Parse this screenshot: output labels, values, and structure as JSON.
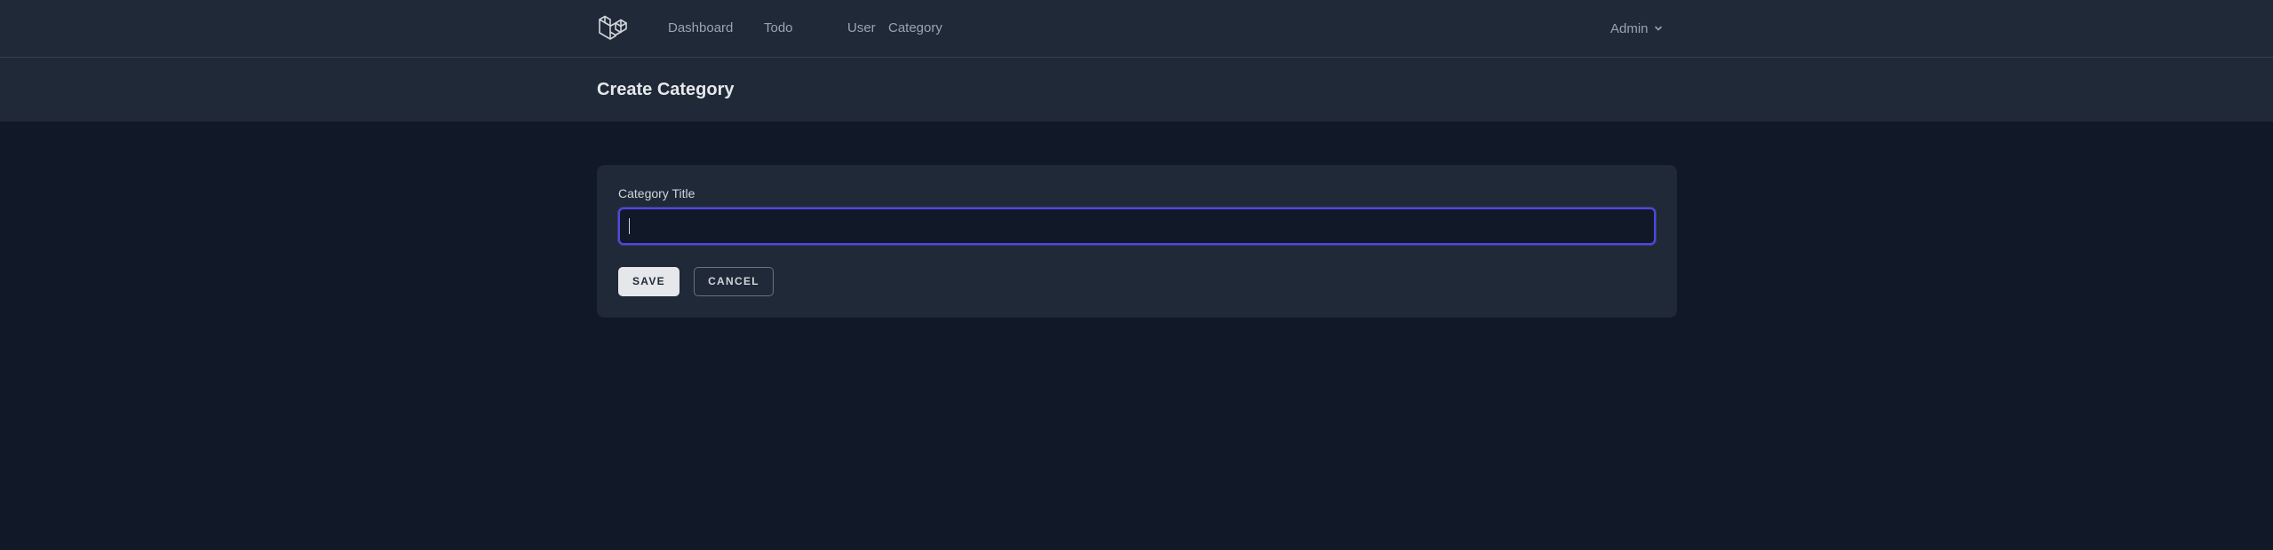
{
  "nav": {
    "logo_icon": "laravel-logo-icon",
    "links": [
      {
        "label": "Dashboard"
      },
      {
        "label": "Todo"
      },
      {
        "label": "User"
      },
      {
        "label": "Category"
      }
    ],
    "user_menu": {
      "label": "Admin",
      "icon": "chevron-down-icon"
    }
  },
  "header": {
    "title": "Create Category"
  },
  "form": {
    "title_label": "Category Title",
    "title_value": "",
    "save_label": "SAVE",
    "cancel_label": "CANCEL"
  },
  "colors": {
    "page_background": "#111827",
    "panel_background": "#1f2937",
    "focus_ring": "#4f46e5",
    "text_muted": "#9ca3af"
  }
}
